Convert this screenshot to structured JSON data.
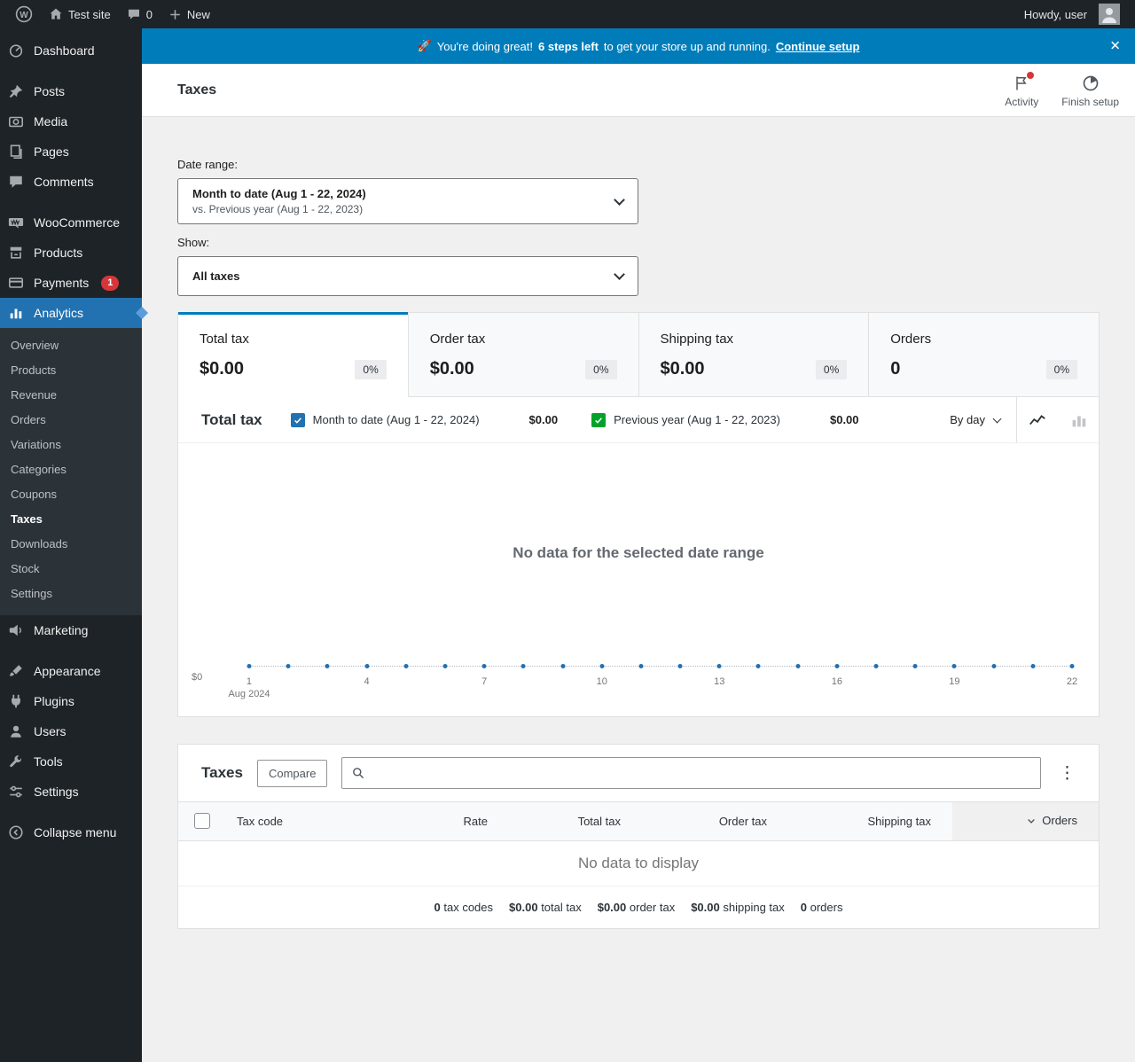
{
  "colors": {
    "accent": "#007cba",
    "banner_bg": "#007cba",
    "active_menu_bg": "#2271b1",
    "notification_red": "#d63638"
  },
  "admin_bar": {
    "site_name": "Test site",
    "comments_count": "0",
    "new_label": "New",
    "greeting": "Howdy, user"
  },
  "banner": {
    "emoji": "🚀",
    "message_lead": "You're doing great!",
    "message_bold": "6 steps left",
    "message_rest": "to get your store up and running.",
    "link_label": "Continue setup"
  },
  "header": {
    "page_title": "Taxes",
    "activity_label": "Activity",
    "finish_setup_label": "Finish setup"
  },
  "sidebar": {
    "items": [
      {
        "label": "Dashboard"
      },
      {
        "label": "Posts"
      },
      {
        "label": "Media"
      },
      {
        "label": "Pages"
      },
      {
        "label": "Comments"
      },
      {
        "label": "WooCommerce"
      },
      {
        "label": "Products"
      },
      {
        "label": "Payments",
        "badge": "1"
      },
      {
        "label": "Analytics",
        "active": true
      },
      {
        "label": "Marketing"
      },
      {
        "label": "Appearance"
      },
      {
        "label": "Plugins"
      },
      {
        "label": "Users"
      },
      {
        "label": "Tools"
      },
      {
        "label": "Settings"
      },
      {
        "label": "Collapse menu"
      }
    ],
    "analytics_submenu": [
      {
        "label": "Overview"
      },
      {
        "label": "Products"
      },
      {
        "label": "Revenue"
      },
      {
        "label": "Orders"
      },
      {
        "label": "Variations"
      },
      {
        "label": "Categories"
      },
      {
        "label": "Coupons"
      },
      {
        "label": "Taxes",
        "active": true
      },
      {
        "label": "Downloads"
      },
      {
        "label": "Stock"
      },
      {
        "label": "Settings"
      }
    ]
  },
  "filters": {
    "date_range_label": "Date range:",
    "date_range_value": "Month to date (Aug 1 - 22, 2024)",
    "date_range_compare": "vs. Previous year (Aug 1 - 22, 2023)",
    "show_label": "Show:",
    "show_value": "All taxes"
  },
  "summary": {
    "cards": [
      {
        "label": "Total tax",
        "value": "$0.00",
        "delta": "0%",
        "selected": true
      },
      {
        "label": "Order tax",
        "value": "$0.00",
        "delta": "0%",
        "selected": false
      },
      {
        "label": "Shipping tax",
        "value": "$0.00",
        "delta": "0%",
        "selected": false
      },
      {
        "label": "Orders",
        "value": "0",
        "delta": "0%",
        "selected": false
      }
    ]
  },
  "chart": {
    "title": "Total tax",
    "legend": [
      {
        "label": "Month to date (Aug 1 - 22, 2024)",
        "value": "$0.00",
        "color": "#2271b1"
      },
      {
        "label": "Previous year (Aug 1 - 22, 2023)",
        "value": "$0.00",
        "color": "#00a32a"
      }
    ],
    "interval_value": "By day",
    "empty_message": "No data for the selected date range",
    "y_axis_label": "$0",
    "x_axis": {
      "days": 22,
      "ticks": [
        1,
        4,
        7,
        10,
        13,
        16,
        19,
        22
      ],
      "first_tick_sublabel": "Aug 2024"
    }
  },
  "chart_data": {
    "type": "line",
    "title": "Total tax",
    "x": [
      1,
      2,
      3,
      4,
      5,
      6,
      7,
      8,
      9,
      10,
      11,
      12,
      13,
      14,
      15,
      16,
      17,
      18,
      19,
      20,
      21,
      22
    ],
    "xlabel": "Aug 2024",
    "ylabel": "",
    "ylim": [
      0,
      0
    ],
    "series": [
      {
        "name": "Month to date (Aug 1 - 22, 2024)",
        "values": [
          0,
          0,
          0,
          0,
          0,
          0,
          0,
          0,
          0,
          0,
          0,
          0,
          0,
          0,
          0,
          0,
          0,
          0,
          0,
          0,
          0,
          0
        ]
      },
      {
        "name": "Previous year (Aug 1 - 22, 2023)",
        "values": [
          0,
          0,
          0,
          0,
          0,
          0,
          0,
          0,
          0,
          0,
          0,
          0,
          0,
          0,
          0,
          0,
          0,
          0,
          0,
          0,
          0,
          0
        ]
      }
    ],
    "legend_position": "top",
    "grid": false,
    "empty": true
  },
  "table": {
    "title": "Taxes",
    "compare_label": "Compare",
    "search_placeholder": "",
    "columns": [
      {
        "label": "Tax code"
      },
      {
        "label": "Rate"
      },
      {
        "label": "Total tax"
      },
      {
        "label": "Order tax"
      },
      {
        "label": "Shipping tax"
      },
      {
        "label": "Orders",
        "sorted": "desc"
      }
    ],
    "empty_message": "No data to display",
    "summary": [
      {
        "value": "0",
        "label": "tax codes"
      },
      {
        "value": "$0.00",
        "label": "total tax"
      },
      {
        "value": "$0.00",
        "label": "order tax"
      },
      {
        "value": "$0.00",
        "label": "shipping tax"
      },
      {
        "value": "0",
        "label": "orders"
      }
    ]
  }
}
